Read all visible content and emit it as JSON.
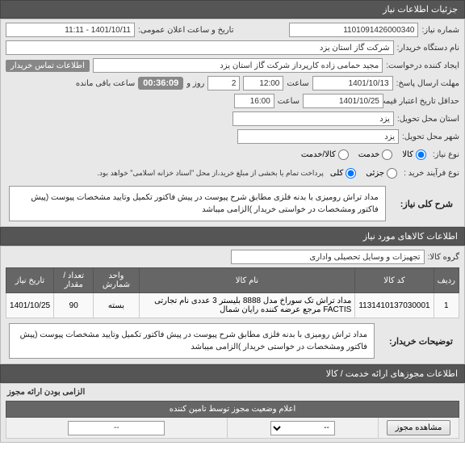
{
  "panel_title": "جزئیات اطلاعات نیاز",
  "req_number_label": "شماره نیاز:",
  "req_number": "1101091426000340",
  "pub_date_label": "تاریخ و ساعت اعلان عمومی:",
  "pub_date": "1401/10/11 - 11:11",
  "buyer_org_label": "نام دستگاه خریدار:",
  "buyer_org": "شرکت گاز استان یزد",
  "requester_label": "ایجاد کننده درخواست:",
  "requester": "مجید حمامی زاده کارپرداز شرکت گاز استان یزد",
  "contact_info": "اطلاعات تماس خریدار",
  "reply_deadline_label": "مهلت ارسال پاسخ:",
  "reply_date": "1401/10/13",
  "time_label": "ساعت",
  "reply_time": "12:00",
  "day_label": "روز و",
  "day_val": "2",
  "time_left": "00:36:09",
  "time_left_label": "ساعت باقی مانده",
  "valid_from_label": "حداقل تاریخ اعتبار قیمت تا تاریخ:",
  "valid_date": "1401/10/25",
  "valid_time": "16:00",
  "delivery_prov_label": "استان محل تحویل:",
  "delivery_prov": "یزد",
  "delivery_city_label": "شهر محل تحویل:",
  "delivery_city": "یزد",
  "need_type_label": "نوع نیاز:",
  "need_opt_goods": "کالا",
  "need_opt_service": "خدمت",
  "need_opt_both": "کالا/خدمت",
  "purchase_type_label": "نوع فرآیند خرید :",
  "purchase_opt_partial": "جزئی",
  "purchase_opt_full": "کلی",
  "purchase_note": "پرداخت تمام یا بخشی از مبلغ خرید،از محل \"اسناد خزانه اسلامی\" خواهد بود.",
  "desc_label": "شرح کلی نیاز:",
  "desc_text": "مداد تراش رومیزی با بدنه فلزی مطابق شرح پیوست در پیش فاکتور تکمیل وتایید مشخصات پیوست (پیش فاکتور ومشخصات در خواستی خریدار )الزامی میباشد",
  "goods_panel": "اطلاعات کالاهای مورد نیاز",
  "group_label": "گروه کالا:",
  "group_value": "تجهیزات و وسایل تحصیلی واداری",
  "th_row": "ردیف",
  "th_code": "کد کالا",
  "th_name": "نام کالا",
  "th_unit": "واحد شمارش",
  "th_qty": "تعداد / مقدار",
  "th_date": "تاریخ نیاز",
  "row_num": "1",
  "row_code": "1131410137030001",
  "row_name": "مداد تراش تک سوراخ مدل 8888 بلیستر 3 عددی نام تجارتی FACTIS مرجع عرضه کننده رایان شمال",
  "row_unit": "بسته",
  "row_qty": "90",
  "row_date": "1401/10/25",
  "buyer_note_label": "توضیحات خریدار:",
  "buyer_note": "مداد تراش رومیزی با بدنه فلزی مطابق شرح پیوست در پیش فاکتور تکمیل وتایید مشخصات پیوست (پیش فاکتور ومشخصات در خواستی خریدار )الزامی میباشد",
  "auth_panel": "اطلاعات مجوزهای ارائه خدمت / کالا",
  "auth_required_label": "الزامی بودن ارائه مجوز",
  "auth_th": "اعلام وضعیت مجوز توسط تامین کننده",
  "auth_btn": "مشاهده مجوز",
  "auth_sel": "--",
  "auth_val": "--"
}
